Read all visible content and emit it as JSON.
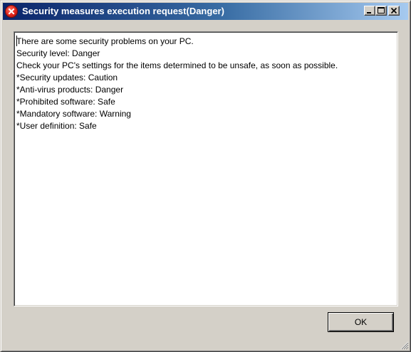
{
  "window": {
    "title": "Security measures execution request(Danger)",
    "title_icon": "error-x-icon",
    "controls": {
      "minimize_icon": "minimize-icon",
      "maximize_icon": "maximize-icon",
      "close_icon": "close-icon"
    }
  },
  "message": {
    "lines": [
      "There are some security problems on your PC.",
      "Security level: Danger",
      "Check your PC's settings for the items determined to be unsafe, as soon as possible.",
      "*Security updates: Caution",
      "*Anti-virus products: Danger",
      "*Prohibited software: Safe",
      "*Mandatory software: Warning",
      "*User definition: Safe"
    ]
  },
  "buttons": {
    "ok_label": "OK"
  },
  "colors": {
    "titlebar_start": "#0a246a",
    "titlebar_end": "#a6caf0",
    "window_face": "#d4d0c8",
    "error_icon_red": "#e0241a"
  }
}
